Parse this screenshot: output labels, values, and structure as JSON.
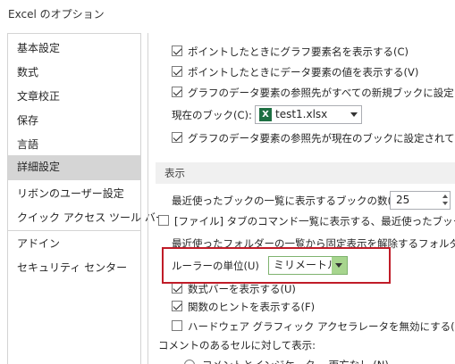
{
  "window": {
    "title": "Excel のオプション"
  },
  "sidebar": {
    "items": [
      {
        "label": "基本設定",
        "selected": false
      },
      {
        "label": "数式",
        "selected": false
      },
      {
        "label": "文章校正",
        "selected": false
      },
      {
        "label": "保存",
        "selected": false
      },
      {
        "label": "言語",
        "selected": false
      },
      {
        "label": "詳細設定",
        "selected": true
      },
      {
        "label": "リボンのユーザー設定",
        "selected": false
      },
      {
        "label": "クイック アクセス ツール バー",
        "selected": false
      },
      {
        "label": "アドイン",
        "selected": false
      },
      {
        "label": "セキュリティ センター",
        "selected": false
      }
    ]
  },
  "chart_options": {
    "opt1": {
      "label": "ポイントしたときにグラフ要素名を表示する(C)",
      "checked": true
    },
    "opt2": {
      "label": "ポイントしたときにデータ要素の値を表示する(V)",
      "checked": true
    },
    "opt3": {
      "label": "グラフのデータ要素の参照先がすべての新規ブックに設定されてい",
      "checked": true
    },
    "current_book_label": "現在のブック(C):",
    "current_book_value": "test1.xlsx",
    "opt4": {
      "label": "グラフのデータ要素の参照先が現在のブックに設定されているプロ",
      "checked": true
    }
  },
  "display": {
    "section_title": "表示",
    "recent_books_label": "最近使ったブックの一覧に表示するブックの数(R):",
    "recent_books_value": "25",
    "quick_access_label": "[ファイル] タブのコマンド一覧に表示する、最近使ったブックの数(",
    "quick_access_checked": false,
    "recent_folders_label": "最近使ったフォルダーの一覧から固定表示を解除するフォルダーの数",
    "ruler_unit_label": "ルーラーの単位(U)",
    "ruler_unit_value": "ミリメートル",
    "formula_bar": {
      "label": "数式バーを表示する(U)",
      "checked": true
    },
    "function_tips": {
      "label": "関数のヒントを表示する(F)",
      "checked": true
    },
    "hw_accel": {
      "label": "ハードウェア グラフィック アクセラレータを無効にする(G)",
      "checked": false
    },
    "comments_label": "コメントのあるセルに対して表示:",
    "comments_option": "コメントとインジケーター 両方なし (N)"
  },
  "colors": {
    "highlight": "#c01c28",
    "sidebar_selected": "#d5d5d5",
    "dropdown_accent": "#a7d58e",
    "excel_green": "#1d6f42"
  }
}
